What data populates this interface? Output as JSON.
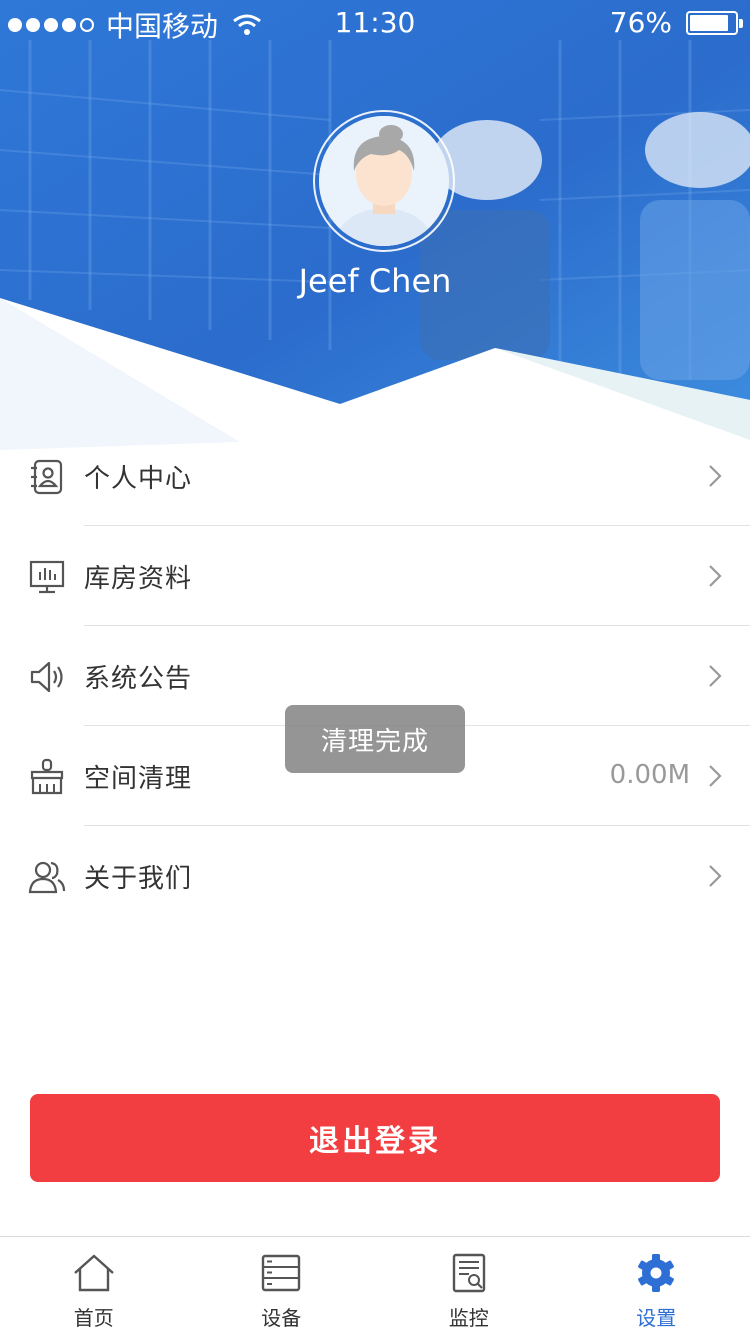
{
  "status_bar": {
    "carrier": "中国移动",
    "time": "11:30",
    "battery": "76%",
    "battery_level": 0.76,
    "signal_bars": 4
  },
  "profile": {
    "name": "Jeef Chen"
  },
  "menu": [
    {
      "label": "个人中心",
      "icon": "contact-icon",
      "value": ""
    },
    {
      "label": "库房资料",
      "icon": "monitor-chart-icon",
      "value": ""
    },
    {
      "label": "系统公告",
      "icon": "speaker-icon",
      "value": ""
    },
    {
      "label": "空间清理",
      "icon": "brush-icon",
      "value": "0.00M"
    },
    {
      "label": "关于我们",
      "icon": "users-icon",
      "value": ""
    }
  ],
  "toast": "清理完成",
  "logout_label": "退出登录",
  "tabs": [
    {
      "label": "首页",
      "icon": "home-icon",
      "active": false
    },
    {
      "label": "设备",
      "icon": "device-list-icon",
      "active": false
    },
    {
      "label": "监控",
      "icon": "monitor-doc-icon",
      "active": false
    },
    {
      "label": "设置",
      "icon": "gear-icon",
      "active": true
    }
  ],
  "colors": {
    "primary": "#2e6fd6",
    "logout": "#f33e41",
    "header": "#2f73d4"
  }
}
